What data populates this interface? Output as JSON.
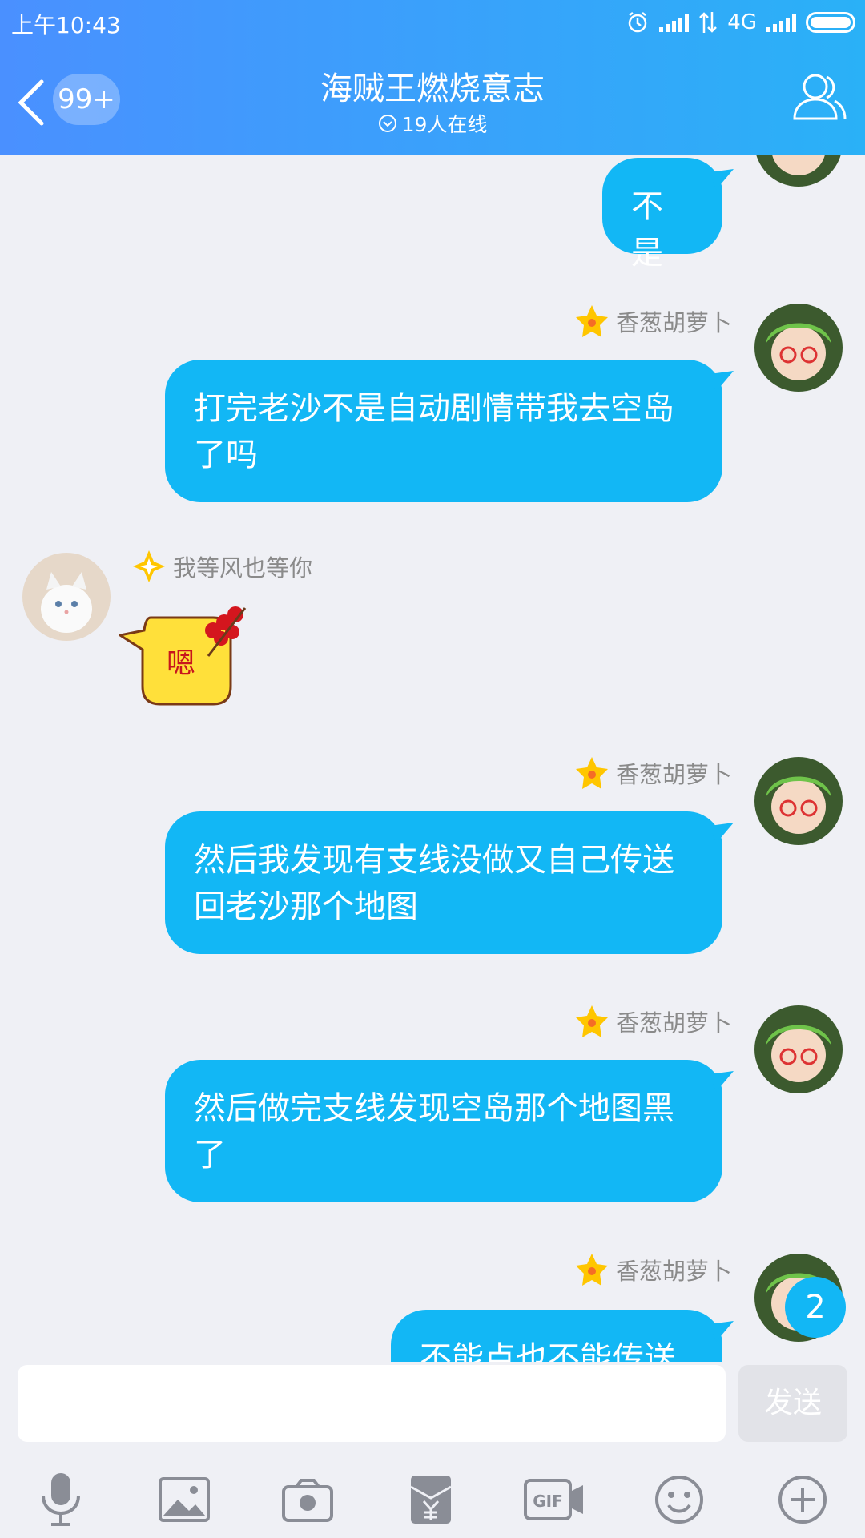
{
  "status_bar": {
    "time": "上午10:43",
    "network": "4G"
  },
  "header": {
    "back_badge": "99+",
    "title": "海贼王燃烧意志",
    "online": "19人在线"
  },
  "messages": [
    {
      "side": "right",
      "text": "不是"
    },
    {
      "side": "right",
      "nickname": "香葱胡萝卜",
      "text": "打完老沙不是自动剧情带我去空岛了吗"
    },
    {
      "side": "left",
      "nickname": "我等风也等你",
      "text": "嗯"
    },
    {
      "side": "right",
      "nickname": "香葱胡萝卜",
      "text": "然后我发现有支线没做又自己传送回老沙那个地图"
    },
    {
      "side": "right",
      "nickname": "香葱胡萝卜",
      "text": "然后做完支线发现空岛那个地图黑了"
    },
    {
      "side": "right",
      "nickname": "香葱胡萝卜",
      "text": "不能点也不能传送"
    }
  ],
  "unread_badge": "2",
  "input": {
    "value": "",
    "send_label": "发送"
  },
  "toolbar": {
    "icons": [
      "microphone-icon",
      "image-icon",
      "camera-icon",
      "red-packet-icon",
      "gif-icon",
      "emoji-icon",
      "plus-icon"
    ]
  },
  "colors": {
    "accent": "#12b7f5",
    "header_start": "#4a90ff",
    "header_end": "#2ab1f7",
    "background": "#eff0f5"
  }
}
